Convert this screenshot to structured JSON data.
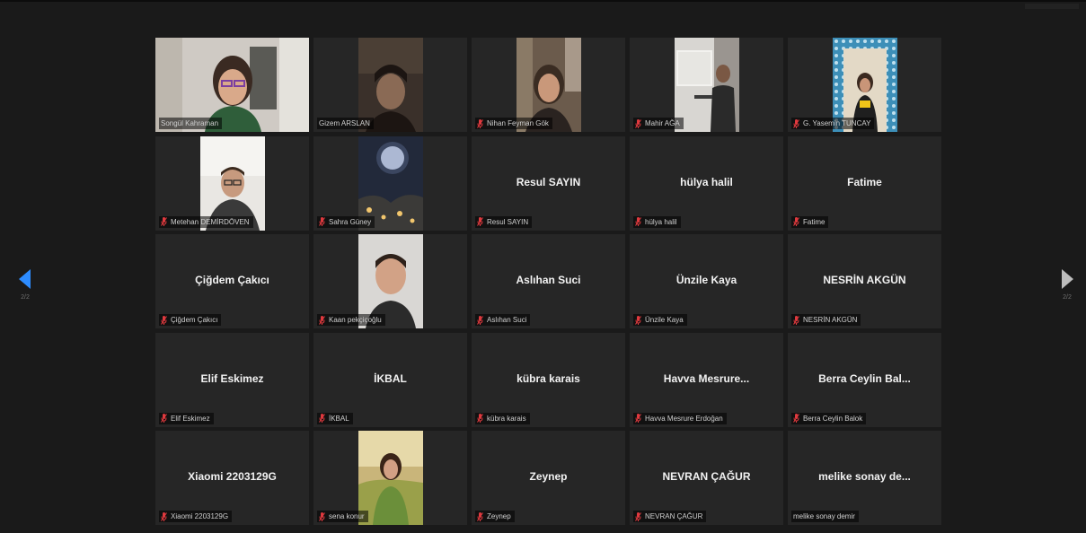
{
  "pagination": {
    "prev_page": "2/2",
    "next_page": "2/2"
  },
  "participants": [
    {
      "name": "Songül Kahraman",
      "label": "Songül Kahraman",
      "video": "woman-glasses-room",
      "muted": false
    },
    {
      "name": "Gizem ARSLAN",
      "label": "Gizem ARSLAN",
      "video": "dark-face",
      "muted": false
    },
    {
      "name": "Nihan Feyman Gök",
      "label": "Nihan Feyman Gök",
      "video": "woman-indoor",
      "muted": true
    },
    {
      "name": "Mahir AĞA",
      "label": "Mahir AĞA",
      "video": "man-screen",
      "muted": true
    },
    {
      "name": "G. Yasemin TUNCAY",
      "label": "G. Yasemin TUNCAY",
      "video": "woman-tile-wall",
      "muted": true
    },
    {
      "name": "Metehan DEMİRDÖVEN",
      "label": "Metehan DEMİRDÖVEN",
      "video": "man-room",
      "muted": true
    },
    {
      "name": "Sahra Güney",
      "label": "Sahra Güney",
      "video": "moon-night",
      "muted": true
    },
    {
      "name": "Resul SAYIN",
      "label": "Resul SAYIN",
      "video": "",
      "muted": true
    },
    {
      "name": "hülya halil",
      "label": "hülya halil",
      "video": "",
      "muted": true
    },
    {
      "name": "Fatime",
      "label": "Fatime",
      "video": "",
      "muted": true
    },
    {
      "name": "Çiğdem Çakıcı",
      "label": "Çiğdem Çakıcı",
      "video": "",
      "muted": true
    },
    {
      "name": "Kaan pekçiçoğlu",
      "label": "Kaan pekçiçoğlu",
      "video": "young-man",
      "muted": true
    },
    {
      "name": "Aslıhan Suci",
      "label": "Aslıhan Suci",
      "video": "",
      "muted": true
    },
    {
      "name": "Ünzile Kaya",
      "label": "Ünzile Kaya",
      "video": "",
      "muted": true
    },
    {
      "name": "NESRİN AKGÜN",
      "label": "NESRİN AKGÜN",
      "video": "",
      "muted": true
    },
    {
      "name": "Elif Eskimez",
      "label": "Elif Eskimez",
      "video": "",
      "muted": true
    },
    {
      "name": "İKBAL",
      "label": "İKBAL",
      "video": "",
      "muted": true
    },
    {
      "name": "kübra karais",
      "label": "kübra karais",
      "video": "",
      "muted": true
    },
    {
      "name": "Havva Mesrure...",
      "label": "Havva Mesrure Erdoğan",
      "video": "",
      "muted": true
    },
    {
      "name": "Berra Ceylin Bal...",
      "label": "Berra Ceylin Balok",
      "video": "",
      "muted": true
    },
    {
      "name": "Xiaomi 2203129G",
      "label": "Xiaomi 2203129G",
      "video": "",
      "muted": true
    },
    {
      "name": "sena konur",
      "label": "sena konur",
      "video": "woman-outdoor",
      "muted": true
    },
    {
      "name": "Zeynep",
      "label": "Zeynep",
      "video": "",
      "muted": true
    },
    {
      "name": "NEVRAN ÇAĞUR",
      "label": "NEVRAN ÇAĞUR",
      "video": "",
      "muted": true
    },
    {
      "name": "melike sonay de...",
      "label": "melike sonay demir",
      "video": "",
      "muted": false
    }
  ],
  "colors": {
    "background": "#1a1a1a",
    "tile": "#262626",
    "muted_icon": "#e0393e",
    "nav_prev": "#2d8cff",
    "nav_next": "#bdbdbd"
  }
}
